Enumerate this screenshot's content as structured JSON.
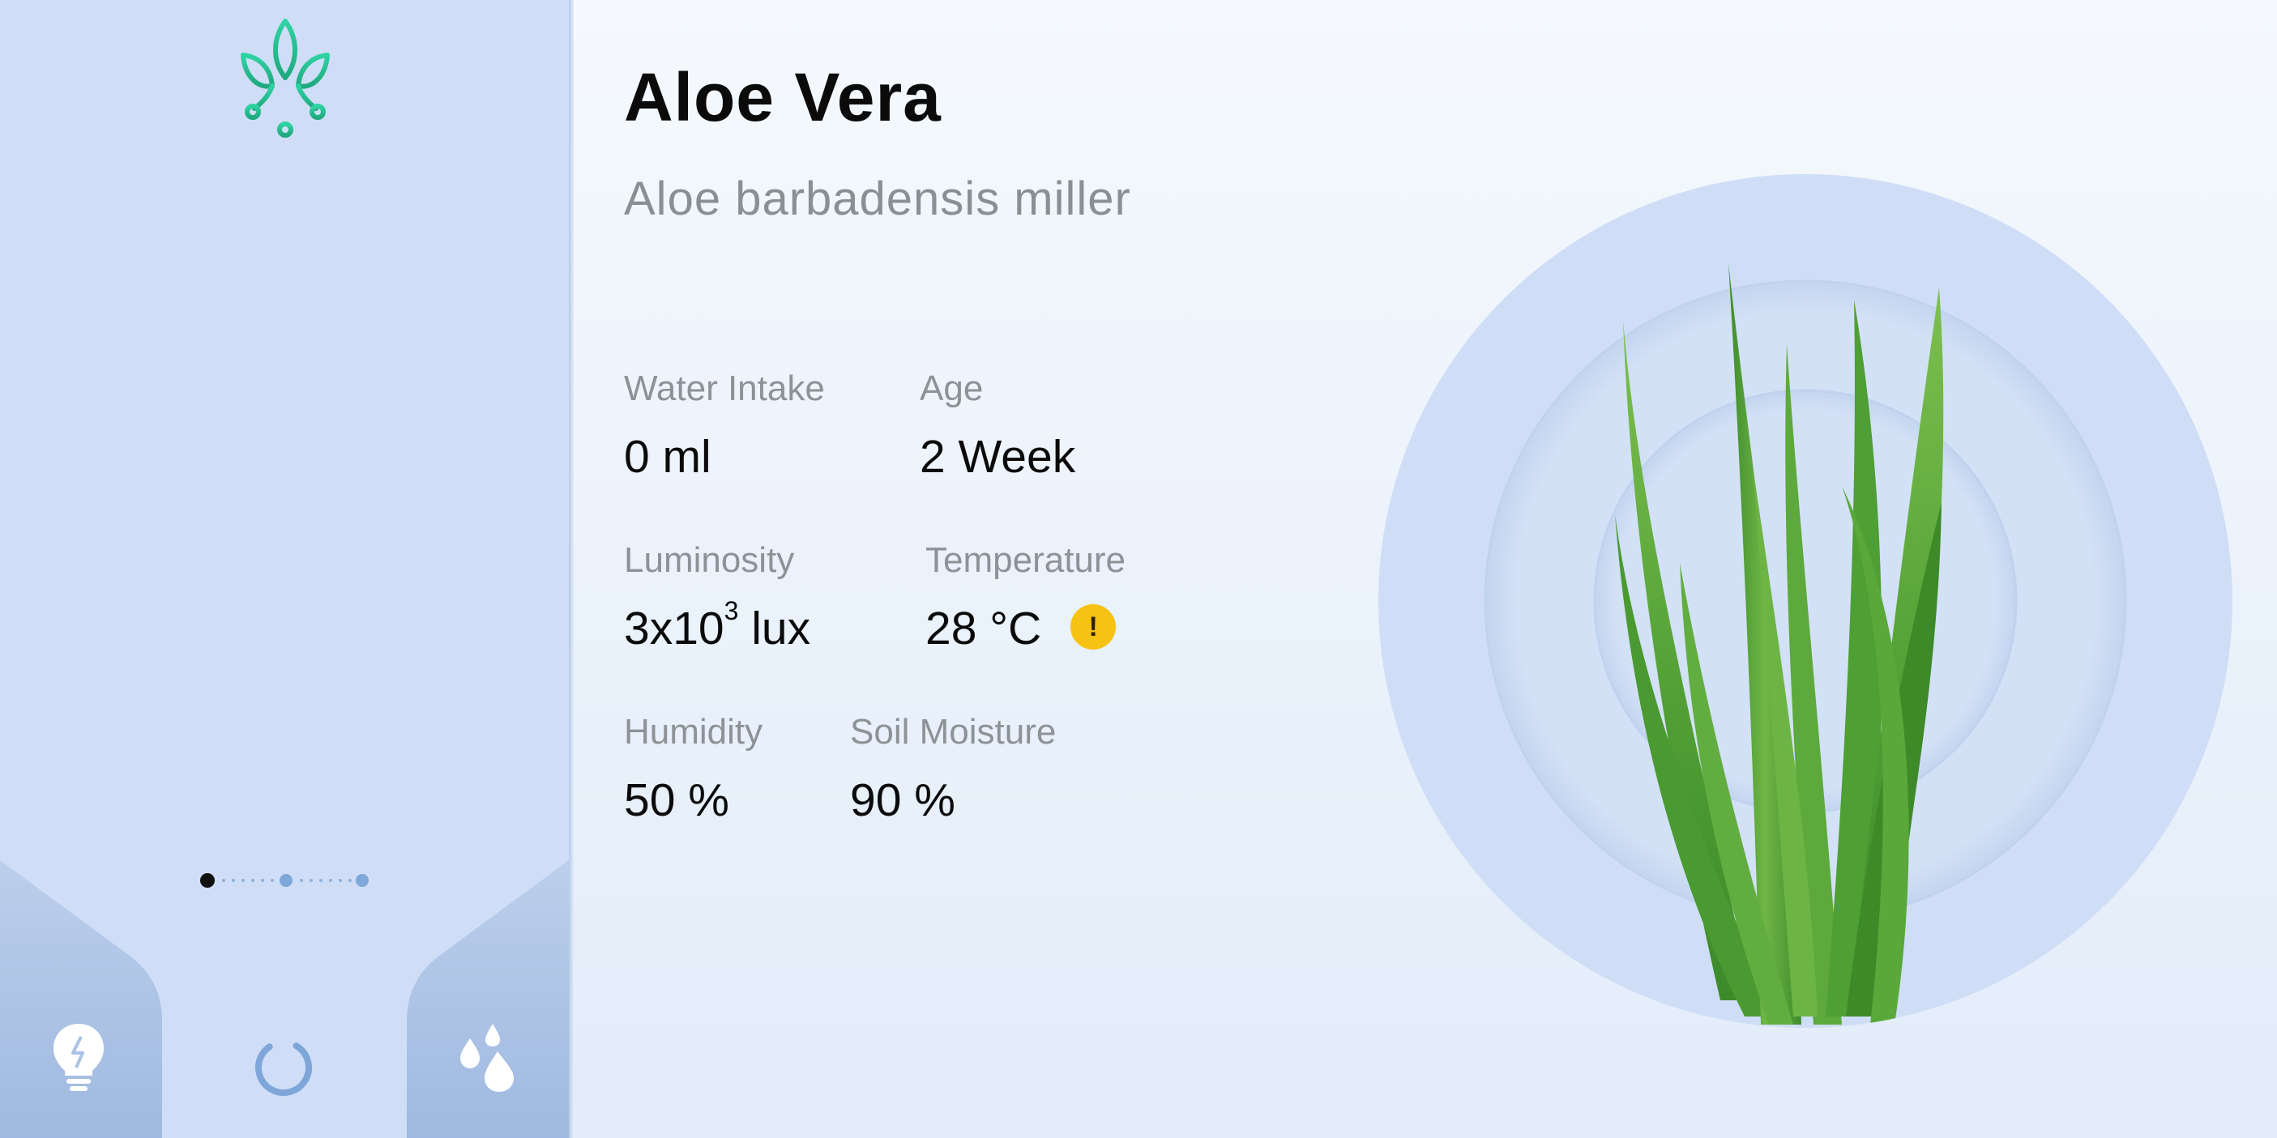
{
  "plant": {
    "name": "Aloe Vera",
    "scientific_name": "Aloe barbadensis miller"
  },
  "stats": {
    "water_intake": {
      "label": "Water Intake",
      "value": "0 ml"
    },
    "age": {
      "label": "Age",
      "value": "2 Week"
    },
    "luminosity": {
      "label": "Luminosity",
      "value_base": "3x10",
      "value_exp": "3",
      "value_unit": " lux"
    },
    "temperature": {
      "label": "Temperature",
      "value": "28 °C",
      "warning_symbol": "!"
    },
    "humidity": {
      "label": "Humidity",
      "value": "50 %"
    },
    "soil_moisture": {
      "label": "Soil Moisture",
      "value": "90 %"
    }
  },
  "pager": {
    "total": 3,
    "active": 1
  },
  "nav": {
    "items": [
      {
        "name": "lightbulb-icon"
      },
      {
        "name": "progress-ring-icon"
      },
      {
        "name": "water-drops-icon"
      }
    ]
  },
  "colors": {
    "sidebar": "#cfdef6",
    "logo_accent": "#2fc79a",
    "warning": "#f6c214",
    "leaf_green": "#5aa83a",
    "halo": "#cfdef6"
  },
  "icons": {
    "logo": "plant-logo-icon",
    "warning": "warning-icon"
  }
}
